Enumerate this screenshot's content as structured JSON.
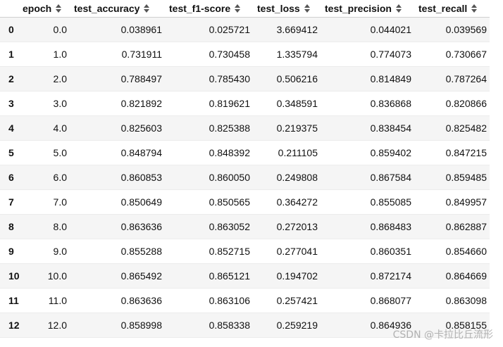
{
  "table": {
    "index_header": "",
    "columns": [
      "epoch",
      "test_accuracy",
      "test_f1-score",
      "test_loss",
      "test_precision",
      "test_recall"
    ],
    "rows": [
      {
        "index": "0",
        "values": [
          "0.0",
          "0.038961",
          "0.025721",
          "3.669412",
          "0.044021",
          "0.039569"
        ]
      },
      {
        "index": "1",
        "values": [
          "1.0",
          "0.731911",
          "0.730458",
          "1.335794",
          "0.774073",
          "0.730667"
        ]
      },
      {
        "index": "2",
        "values": [
          "2.0",
          "0.788497",
          "0.785430",
          "0.506216",
          "0.814849",
          "0.787264"
        ]
      },
      {
        "index": "3",
        "values": [
          "3.0",
          "0.821892",
          "0.819621",
          "0.348591",
          "0.836868",
          "0.820866"
        ]
      },
      {
        "index": "4",
        "values": [
          "4.0",
          "0.825603",
          "0.825388",
          "0.219375",
          "0.838454",
          "0.825482"
        ]
      },
      {
        "index": "5",
        "values": [
          "5.0",
          "0.848794",
          "0.848392",
          "0.211105",
          "0.859402",
          "0.847215"
        ]
      },
      {
        "index": "6",
        "values": [
          "6.0",
          "0.860853",
          "0.860050",
          "0.249808",
          "0.867584",
          "0.859485"
        ]
      },
      {
        "index": "7",
        "values": [
          "7.0",
          "0.850649",
          "0.850565",
          "0.364272",
          "0.855085",
          "0.849957"
        ]
      },
      {
        "index": "8",
        "values": [
          "8.0",
          "0.863636",
          "0.863052",
          "0.272013",
          "0.868483",
          "0.862887"
        ]
      },
      {
        "index": "9",
        "values": [
          "9.0",
          "0.855288",
          "0.852715",
          "0.277041",
          "0.860351",
          "0.854660"
        ]
      },
      {
        "index": "10",
        "values": [
          "10.0",
          "0.865492",
          "0.865121",
          "0.194702",
          "0.872174",
          "0.864669"
        ]
      },
      {
        "index": "11",
        "values": [
          "11.0",
          "0.863636",
          "0.863106",
          "0.257421",
          "0.868077",
          "0.863098"
        ]
      },
      {
        "index": "12",
        "values": [
          "12.0",
          "0.858998",
          "0.858338",
          "0.259219",
          "0.864936",
          "0.858155"
        ]
      }
    ]
  },
  "watermark": "CSDN @卡拉比丘流形",
  "icons": {
    "sort": "sort-both-icon"
  }
}
